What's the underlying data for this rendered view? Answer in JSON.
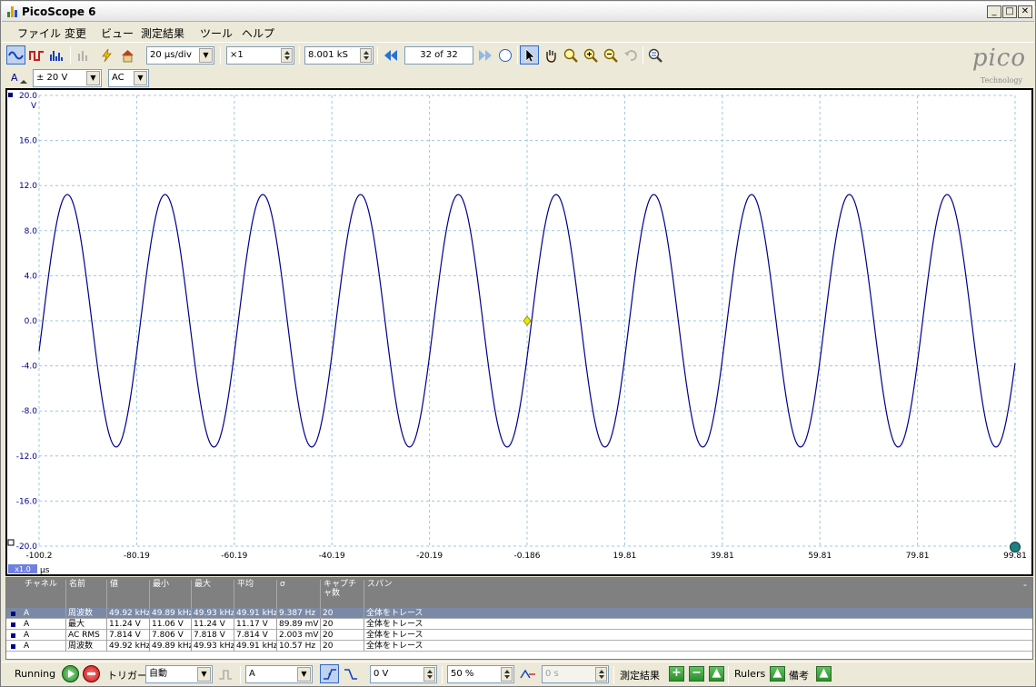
{
  "window": {
    "title": "PicoScope 6"
  },
  "menu": [
    "ファイル",
    "変更",
    "ビュー",
    "測定結果",
    "ツール",
    "ヘルプ"
  ],
  "toolbar": {
    "timebase": "20 µs/div",
    "zoom": "×1",
    "samples": "8.001 kS",
    "buffer": "32 of 32"
  },
  "channel": {
    "name": "A",
    "range": "± 20 V",
    "coupling": "AC"
  },
  "logo": {
    "brand": "pico",
    "sub": "Technology"
  },
  "scope": {
    "y_unit": "V",
    "y_ticks": [
      "20.0",
      "16.0",
      "12.0",
      "8.0",
      "4.0",
      "0.0",
      "-4.0",
      "-8.0",
      "-12.0",
      "-16.0",
      "-20.0"
    ],
    "x_ticks": [
      "-100.2",
      "-80.19",
      "-60.19",
      "-40.19",
      "-20.19",
      "-0.186",
      "19.81",
      "39.81",
      "59.81",
      "79.81",
      "99.81"
    ],
    "x_unit": "µs",
    "x_scale": "x1.0",
    "colors": {
      "trace": "#00008b",
      "grid": "#9cc8e0",
      "trigger": "#e8e800",
      "axis_label": "#00008b"
    }
  },
  "chart_data": {
    "type": "line",
    "title": "",
    "xlabel": "µs",
    "ylabel": "V",
    "xlim": [
      -100.2,
      99.81
    ],
    "ylim": [
      -20,
      20
    ],
    "grid": true,
    "series": [
      {
        "amplitude": 11.2,
        "frequency_khz": 49.92,
        "phase_at_x0_deg": -14
      }
    ]
  },
  "measurements": {
    "headers": [
      "チャネル",
      "名前",
      "値",
      "最小",
      "最大",
      "平均",
      "σ",
      "キャプチャ数",
      "スパン"
    ],
    "rows": [
      [
        "A",
        "周波数",
        "49.92 kHz",
        "49.89 kHz",
        "49.93 kHz",
        "49.91 kHz",
        "9.387 Hz",
        "20",
        "全体をトレース"
      ],
      [
        "A",
        "最大",
        "11.24 V",
        "11.06 V",
        "11.24 V",
        "11.17 V",
        "89.89 mV",
        "20",
        "全体をトレース"
      ],
      [
        "A",
        "AC RMS",
        "7.814 V",
        "7.806 V",
        "7.818 V",
        "7.814 V",
        "2.003 mV",
        "20",
        "全体をトレース"
      ],
      [
        "A",
        "周波数",
        "49.92 kHz",
        "49.89 kHz",
        "49.93 kHz",
        "49.91 kHz",
        "10.57 Hz",
        "20",
        "全体をトレース"
      ]
    ]
  },
  "status": {
    "state": "Running",
    "trigger_label": "トリガー",
    "trigger_mode": "自動",
    "trigger_channel": "A",
    "trigger_level": "0 V",
    "pretrigger": "50 %",
    "delay": "0 s",
    "measurements_label": "測定結果",
    "rulers_label": "Rulers",
    "notes_label": "備考"
  }
}
